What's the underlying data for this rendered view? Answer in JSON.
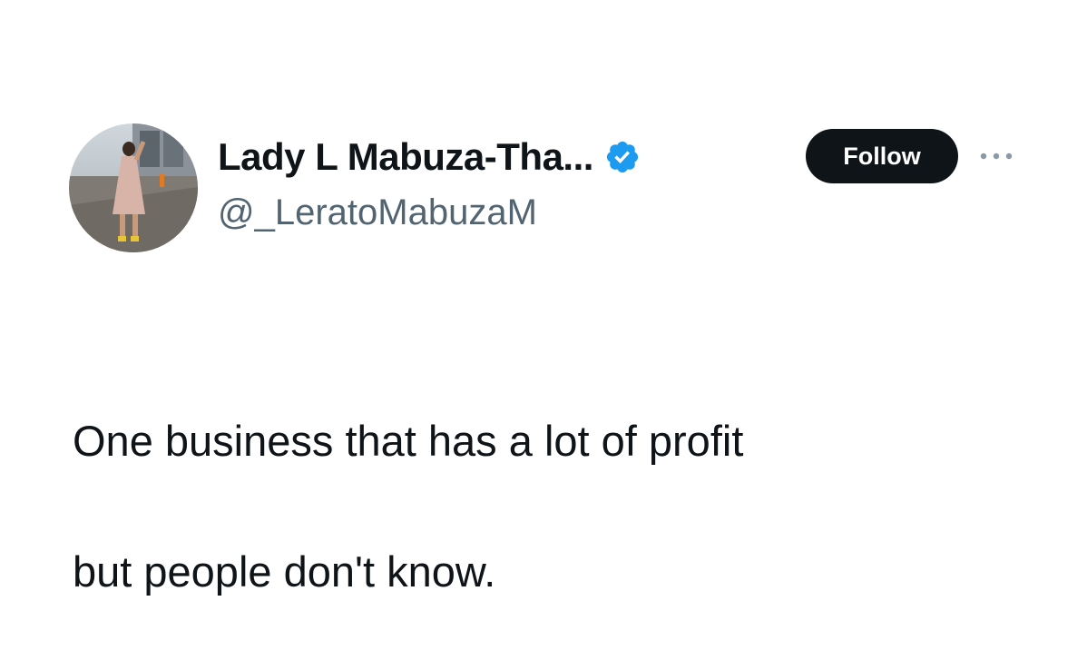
{
  "tweet": {
    "author": {
      "display_name": "Lady L Mabuza-Tha...",
      "handle": "@_LeratoMabuzaM",
      "verified": true,
      "avatar_icon": "profile-photo"
    },
    "follow_label": "Follow",
    "more_icon": "more-horizontal-icon",
    "text_line1": "One business that has a lot of profit",
    "text_line2": "but people don't know."
  },
  "colors": {
    "text_primary": "#0f1419",
    "text_secondary": "#536471",
    "verified_blue": "#1d9bf0",
    "follow_bg": "#0f1419",
    "follow_text": "#ffffff",
    "background": "#ffffff"
  }
}
